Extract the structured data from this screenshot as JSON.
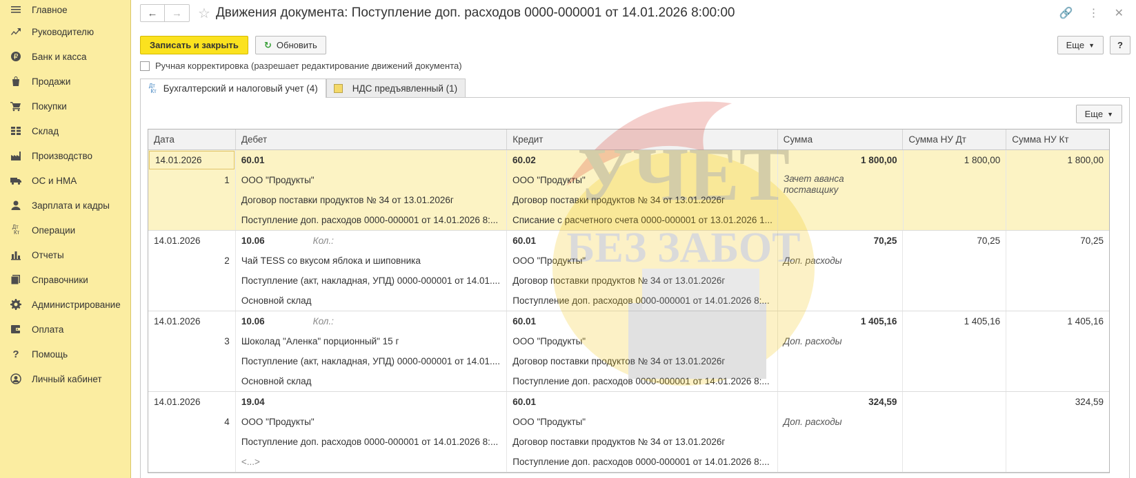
{
  "sidebar": {
    "items": [
      {
        "label": "Главное",
        "icon": "menu-icon"
      },
      {
        "label": "Руководителю",
        "icon": "trend-icon"
      },
      {
        "label": "Банк и касса",
        "icon": "ruble-icon"
      },
      {
        "label": "Продажи",
        "icon": "bag-icon"
      },
      {
        "label": "Покупки",
        "icon": "cart-icon"
      },
      {
        "label": "Склад",
        "icon": "warehouse-icon"
      },
      {
        "label": "Производство",
        "icon": "factory-icon"
      },
      {
        "label": "ОС и НМА",
        "icon": "truck-icon"
      },
      {
        "label": "Зарплата и кадры",
        "icon": "person-icon"
      },
      {
        "label": "Операции",
        "icon": "dt-kt-icon"
      },
      {
        "label": "Отчеты",
        "icon": "bar-chart-icon"
      },
      {
        "label": "Справочники",
        "icon": "books-icon"
      },
      {
        "label": "Администрирование",
        "icon": "gear-icon"
      },
      {
        "label": "Оплата",
        "icon": "wallet-icon"
      },
      {
        "label": "Помощь",
        "icon": "question-icon"
      },
      {
        "label": "Личный кабинет",
        "icon": "user-circle-icon"
      }
    ]
  },
  "header": {
    "title": "Движения документа: Поступление доп. расходов 0000-000001 от 14.01.2026 8:00:00"
  },
  "toolbar": {
    "save_close": "Записать и закрыть",
    "refresh": "Обновить",
    "more": "Еще",
    "help": "?"
  },
  "manual_correction": {
    "label": "Ручная корректировка (разрешает редактирование движений документа)",
    "checked": false
  },
  "tabs": [
    {
      "label": "Бухгалтерский и налоговый учет (4)",
      "icon_top": "Дт",
      "icon_bottom": "Кт",
      "active": true
    },
    {
      "label": "НДС предъявленный (1)",
      "active": false
    }
  ],
  "panel": {
    "more": "Еще"
  },
  "table": {
    "columns": [
      "Дата",
      "Дебет",
      "Кредит",
      "Сумма",
      "Сумма НУ Дт",
      "Сумма НУ Кт"
    ],
    "records": [
      {
        "date": "14.01.2026",
        "num": "1",
        "debit": [
          "60.01",
          "ООО \"Продукты\"",
          "Договор поставки продуктов № 34 от 13.01.2026г",
          "Поступление доп. расходов 0000-000001 от 14.01.2026 8:..."
        ],
        "debit_qty": "",
        "credit": [
          "60.02",
          "ООО \"Продукты\"",
          "Договор поставки продуктов № 34 от 13.01.2026г",
          "Списание с расчетного счета 0000-000001 от 13.01.2026 1..."
        ],
        "sum": "1 800,00",
        "content": "Зачет аванса поставщику",
        "nu_dt": "1 800,00",
        "nu_kt": "1 800,00"
      },
      {
        "date": "14.01.2026",
        "num": "2",
        "debit": [
          "10.06",
          "Чай TESS со вкусом яблока и шиповника",
          "Поступление (акт, накладная, УПД) 0000-000001 от 14.01....",
          "Основной склад"
        ],
        "debit_qty": "Кол.:",
        "credit": [
          "60.01",
          "ООО \"Продукты\"",
          "Договор поставки продуктов № 34 от 13.01.2026г",
          "Поступление доп. расходов 0000-000001 от 14.01.2026 8:..."
        ],
        "sum": "70,25",
        "content": "Доп. расходы",
        "nu_dt": "70,25",
        "nu_kt": "70,25"
      },
      {
        "date": "14.01.2026",
        "num": "3",
        "debit": [
          "10.06",
          "Шоколад \"Аленка\" порционный\" 15 г",
          "Поступление (акт, накладная, УПД) 0000-000001 от 14.01....",
          "Основной склад"
        ],
        "debit_qty": "Кол.:",
        "credit": [
          "60.01",
          "ООО \"Продукты\"",
          "Договор поставки продуктов № 34 от 13.01.2026г",
          "Поступление доп. расходов 0000-000001 от 14.01.2026 8:..."
        ],
        "sum": "1 405,16",
        "content": "Доп. расходы",
        "nu_dt": "1 405,16",
        "nu_kt": "1 405,16"
      },
      {
        "date": "14.01.2026",
        "num": "4",
        "debit": [
          "19.04",
          "ООО \"Продукты\"",
          "Поступление доп. расходов 0000-000001 от 14.01.2026 8:...",
          "<...>"
        ],
        "debit_qty": "",
        "credit": [
          "60.01",
          "ООО \"Продукты\"",
          "Договор поставки продуктов № 34 от 13.01.2026г",
          "Поступление доп. расходов 0000-000001 от 14.01.2026 8:..."
        ],
        "sum": "324,59",
        "content": "Доп. расходы",
        "nu_dt": "",
        "nu_kt": "324,59"
      }
    ]
  },
  "watermark": {
    "line1": "УЧЕТ",
    "line2": "БЕЗ ЗАБОТ"
  },
  "colors": {
    "sidebar_bg": "#fbeda1",
    "primary_button": "#fbe21f",
    "selected_row": "#fcf3c4"
  }
}
